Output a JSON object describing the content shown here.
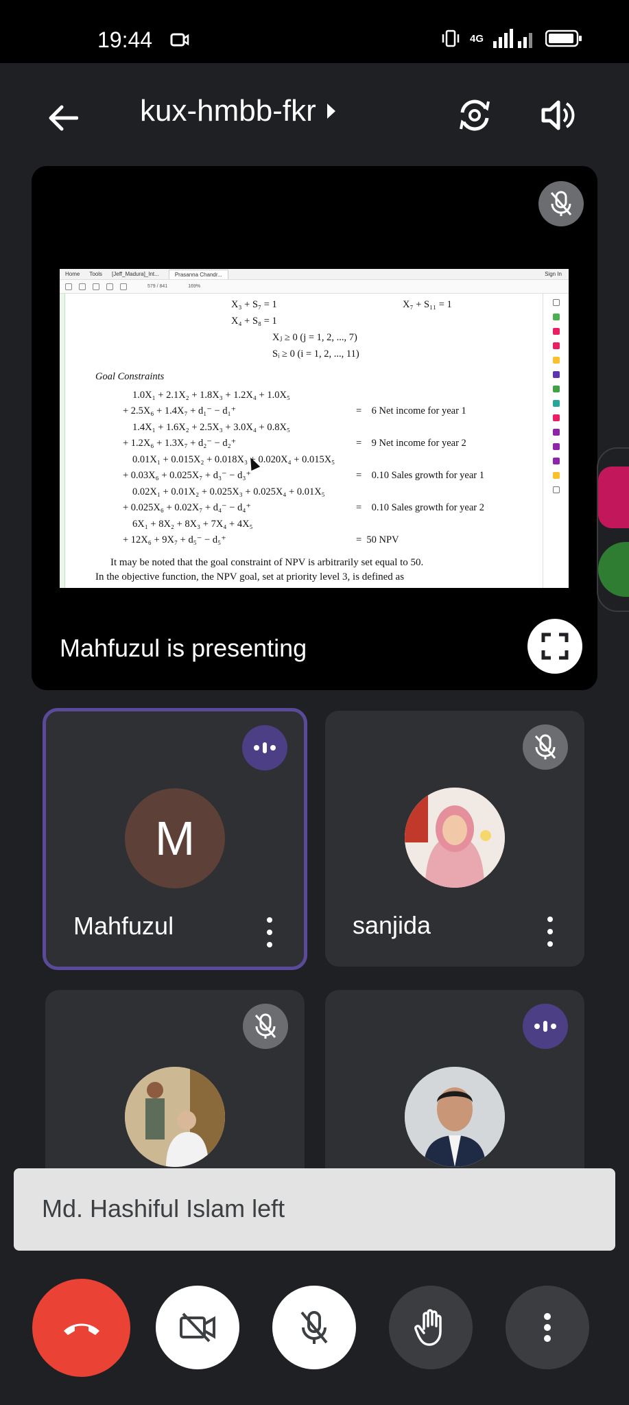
{
  "status_bar": {
    "time": "19:44",
    "network": "4G"
  },
  "header": {
    "meeting_code": "kux-hmbb-fkr"
  },
  "presentation": {
    "presenter_label": "Mahfuzul is presenting",
    "viewer": {
      "tabs": [
        "Home",
        "Tools",
        "[Jeff_Madura]_Int...",
        "Prasanna Chandr...",
        "Sign In"
      ],
      "page_indicator": "579 / 841",
      "zoom": "169%"
    },
    "document_lines": [
      "X₃ + S₇ = 1",
      "X₇ + S₁₁ = 1",
      "X₄ + S₈ = 1",
      "Xⱼ ≥ 0 (j = 1, 2, ..., 7)",
      "Sᵢ ≥ 0 (i = 1, 2, ..., 11)",
      "Goal Constraints",
      "1.0X₁ + 2.1X₂ + 1.8X₃ + 1.2X₄ + 1.0X₅",
      "+ 2.5X₆ + 1.4X₇ + d₁⁻ − d₁⁺",
      "=    6 Net income for year 1",
      "1.4X₁ + 1.6X₂ + 2.5X₃ + 3.0X₄ + 0.8X₅",
      "+ 1.2X₆ + 1.3X₇ + d₂⁻ − d₂⁺",
      "=    9 Net income for year 2",
      "0.01X₁ + 0.015X₂ + 0.018X₃ + 0.020X₄ + 0.015X₅",
      "+ 0.03X₆ + 0.025X₇ + d₃⁻ − d₃⁺",
      "=    0.10 Sales growth for year 1",
      "0.02X₁ + 0.01X₂ + 0.025X₃ + 0.025X₄ + 0.01X₅",
      "+ 0.025X₆ + 0.02X₇ + d₄⁻ − d₄⁺",
      "=    0.10 Sales growth for year 2",
      "6X₁ + 8X₂ + 8X₃ + 7X₄ + 4X₅",
      "+ 12X₆ + 9X₇ + d₅⁻ − d₅⁺",
      "=  50 NPV",
      "It may be noted that the goal constraint of NPV is arbitrarily set equal to 50.",
      "In the objective function, the NPV goal, set at priority level 3, is defined as"
    ]
  },
  "participants": [
    {
      "name": "Mahfuzul",
      "avatar_letter": "M",
      "status": "speaking",
      "active": true
    },
    {
      "name": "sanjida",
      "status": "muted"
    },
    {
      "name": "",
      "status": "muted"
    },
    {
      "name": "",
      "status": "speaking"
    }
  ],
  "toast": {
    "message": "Md. Hashiful Islam left"
  },
  "colors": {
    "end_call": "#ea4335",
    "speaking_badge": "#4d3f86",
    "active_border": "#5b4a99"
  }
}
